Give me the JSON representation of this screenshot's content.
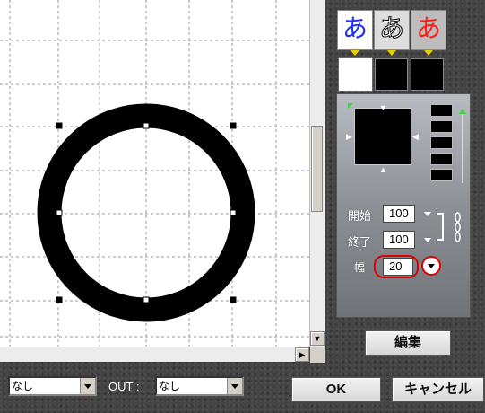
{
  "toolbar": {
    "kana_buttons": [
      {
        "glyph": "あ",
        "style": "blue"
      },
      {
        "glyph": "あ",
        "style": "outlined"
      },
      {
        "glyph": "あ",
        "style": "red"
      }
    ]
  },
  "colors": {
    "kana_blue": "#1a2dff",
    "kana_red": "#ff1a1a",
    "highlight_red": "#e00000",
    "panel_bg": "#444444",
    "canvas_bg": "#ffffff"
  },
  "gradient_panel": {
    "start_label": "開始",
    "start_value": "100",
    "end_label": "終了",
    "end_value": "100",
    "width_label": "幅",
    "width_value": "20",
    "chain_icon": "chain-link-icon"
  },
  "buttons": {
    "edit": "編集",
    "ok": "OK",
    "cancel": "キャンセル"
  },
  "footer": {
    "in_select_value": "なし",
    "out_label": "OUT :",
    "out_select_value": "なし"
  }
}
